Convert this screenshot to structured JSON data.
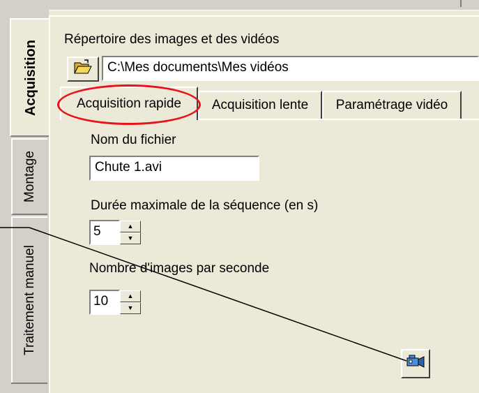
{
  "sidebar": {
    "tabs": [
      {
        "label": "Acquisition"
      },
      {
        "label": "Montage"
      },
      {
        "label": "Traitement manuel"
      }
    ]
  },
  "directory": {
    "label": "Répertoire des images et des vidéos",
    "path": "C:\\Mes documents\\Mes vidéos"
  },
  "tabs": [
    {
      "label": "Acquisition rapide"
    },
    {
      "label": "Acquisition lente"
    },
    {
      "label": "Paramétrage vidéo"
    }
  ],
  "form": {
    "filename_label": "Nom du fichier",
    "filename_value": "Chute 1.avi",
    "duration_label": "Durée maximale de la séquence (en s)",
    "duration_value": "5",
    "fps_label": "Nombre d'images par seconde",
    "fps_value": "10"
  },
  "colors": {
    "highlight": "#e8141b",
    "panel": "#ece9d8"
  },
  "icons": {
    "folder": "open-folder-icon",
    "camera": "video-camera-icon"
  }
}
